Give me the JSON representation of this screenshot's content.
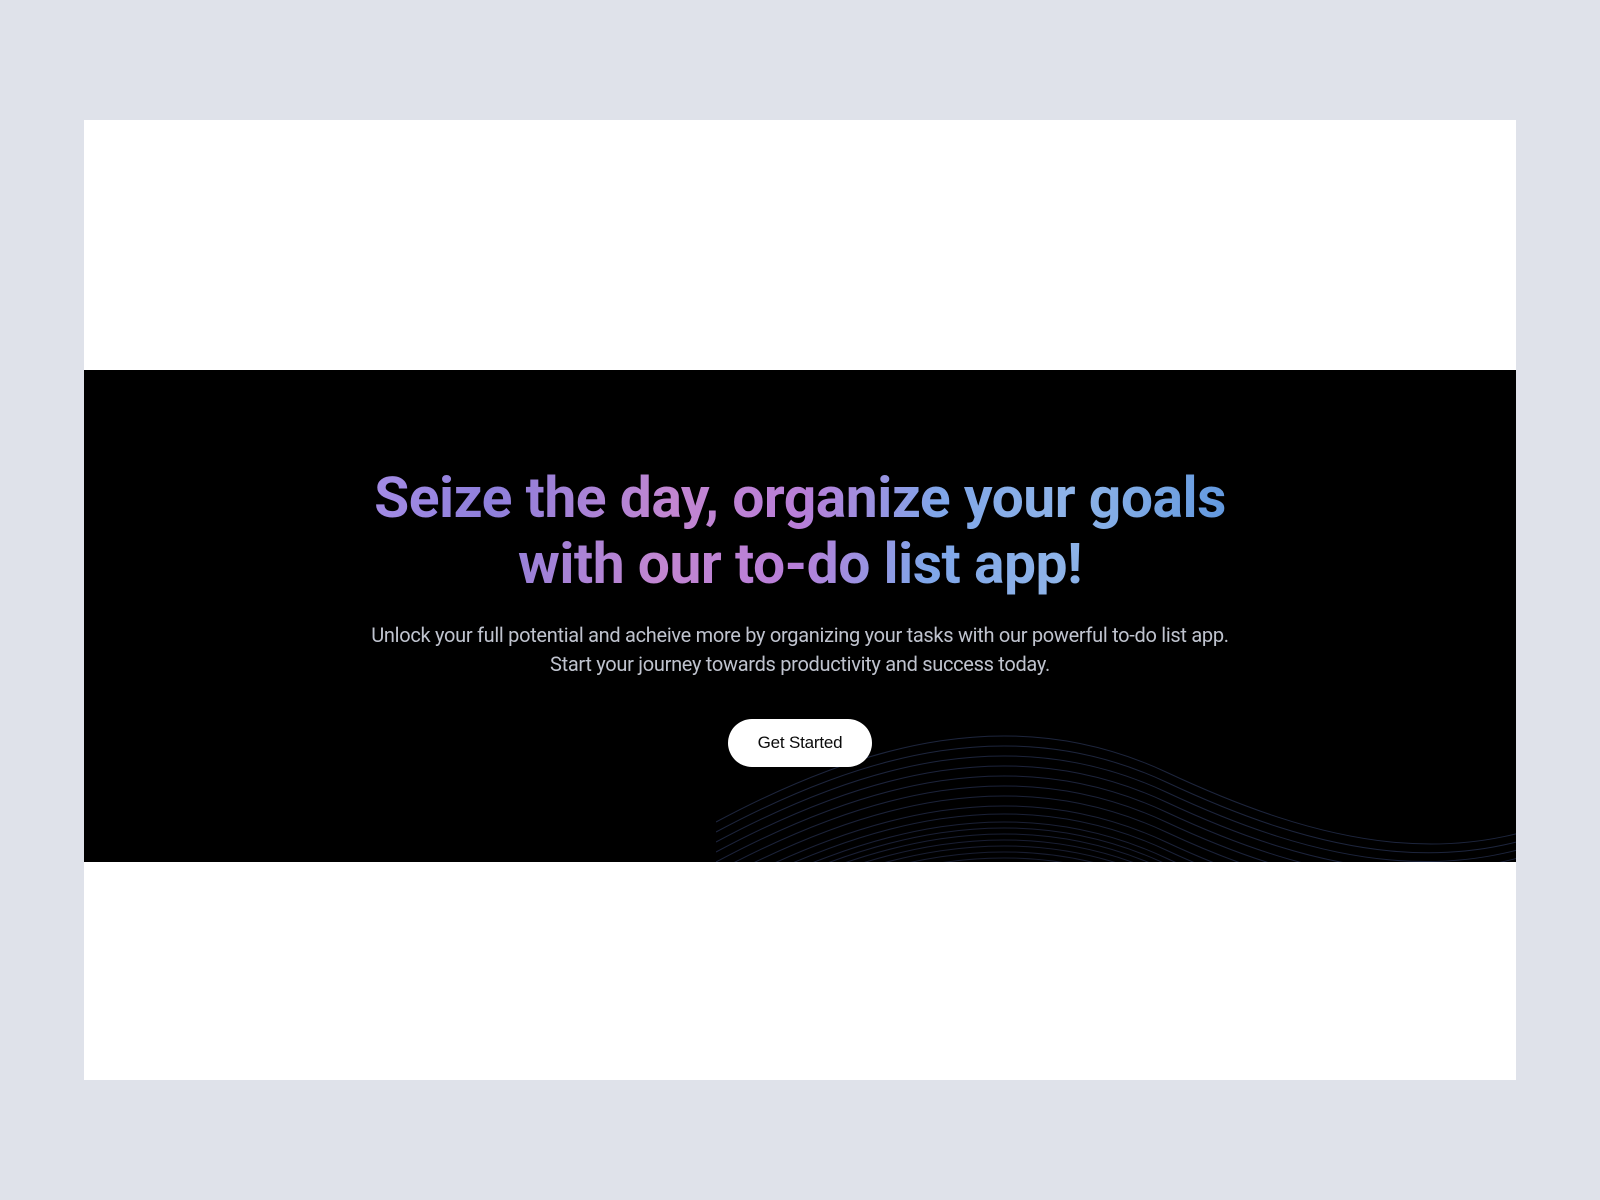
{
  "hero": {
    "headline": "Seize the day, organize your goals with our to-do list app!",
    "subtitle": "Unlock your full potential and acheive more by organizing your tasks with our powerful to-do list app. Start your journey towards productivity and success today.",
    "cta_label": "Get Started"
  }
}
